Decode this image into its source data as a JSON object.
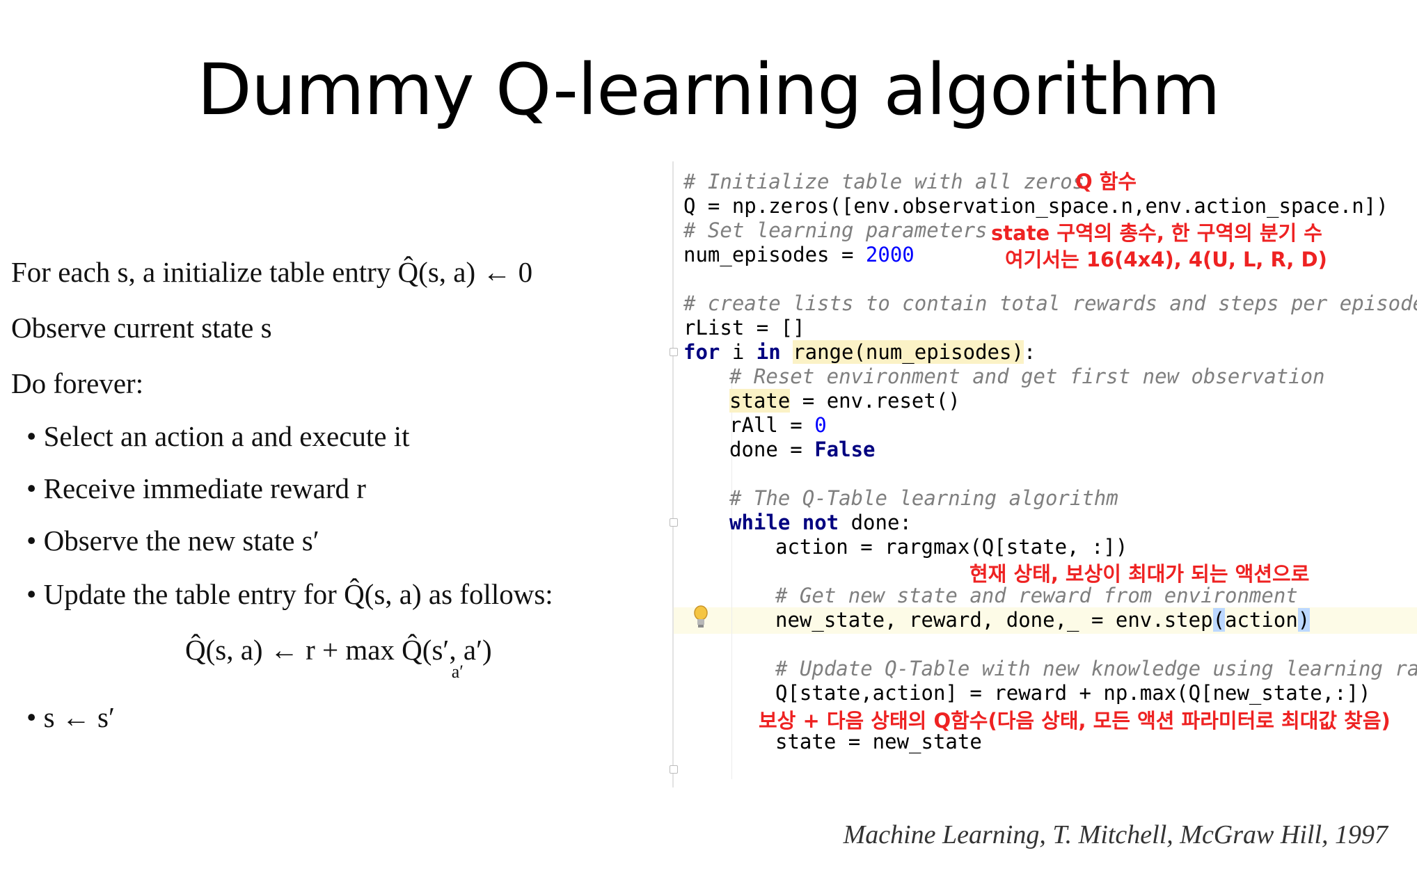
{
  "slide_title": "Dummy Q-learning algorithm",
  "algorithm": {
    "line1": "For each s, a initialize table entry Q̂(s, a) ← 0",
    "line2": "Observe current state s",
    "line3": "Do forever:",
    "bullets": [
      "• Select an action a and execute it",
      "• Receive immediate reward r",
      "• Observe the new state s′",
      "• Update the table entry for Q̂(s, a) as follows:"
    ],
    "formula": "Q̂(s, a) ← r +   max Q̂(s′, a′)",
    "formula_sub": "a′",
    "last_bullet": "• s ← s′"
  },
  "code": {
    "l1_comment": "# Initialize table with all zeros",
    "l2": "Q = np.zeros([env.observation_space.n,env.action_space.n])",
    "l3_comment": "# Set learning parameters",
    "l4_a": "num_episodes = ",
    "l4_num": "2000",
    "l6_comment": "# create lists to contain total rewards and steps per episode",
    "l7": "rList = []",
    "l8_for": "for",
    "l8_i": " i ",
    "l8_in": "in",
    "l8_range": "range(num_episodes)",
    "l8_end": ":",
    "l9_comment": "# Reset environment and get first new observation",
    "l10_state": "state",
    "l10_rest": " = env.reset()",
    "l11_a": "rAll = ",
    "l11_num": "0",
    "l12_a": "done = ",
    "l12_kw": "False",
    "l14_comment": "# The Q-Table learning algorithm",
    "l15_kw": "while not",
    "l15_rest": " done:",
    "l16": "action = rargmax(Q[state, :])",
    "l18_comment": "# Get new state and reward from environment",
    "l19_a": "new_state, reward, done,_ = env.step",
    "l19_p1": "(",
    "l19_b": "action",
    "l19_p2": ")",
    "l21_comment": "# Update Q-Table with new knowledge using learning rate",
    "l22": "Q[state,action] = reward + np.max(Q[new_state,:])",
    "l24": "state = new_state"
  },
  "annotations": {
    "q_func": "Q 함수",
    "state_total": "state 구역의 총수, 한 구역의 분기 수",
    "here": "여기서는 16(4x4), 4(U, L, R, D)",
    "action_note": "현재 상태, 보상이 최대가 되는 액션으로",
    "update_note": "보상 + 다음 상태의 Q함수(다음 상태, 모든 액션 파라미터로 최대값 찾음)"
  },
  "reference": "Machine Learning, T. Mitchell, McGraw Hill, 1997",
  "colors": {
    "annotation": "#ee2222",
    "keyword": "#000080",
    "number": "#0000ff",
    "comment": "#7f7f7f"
  }
}
